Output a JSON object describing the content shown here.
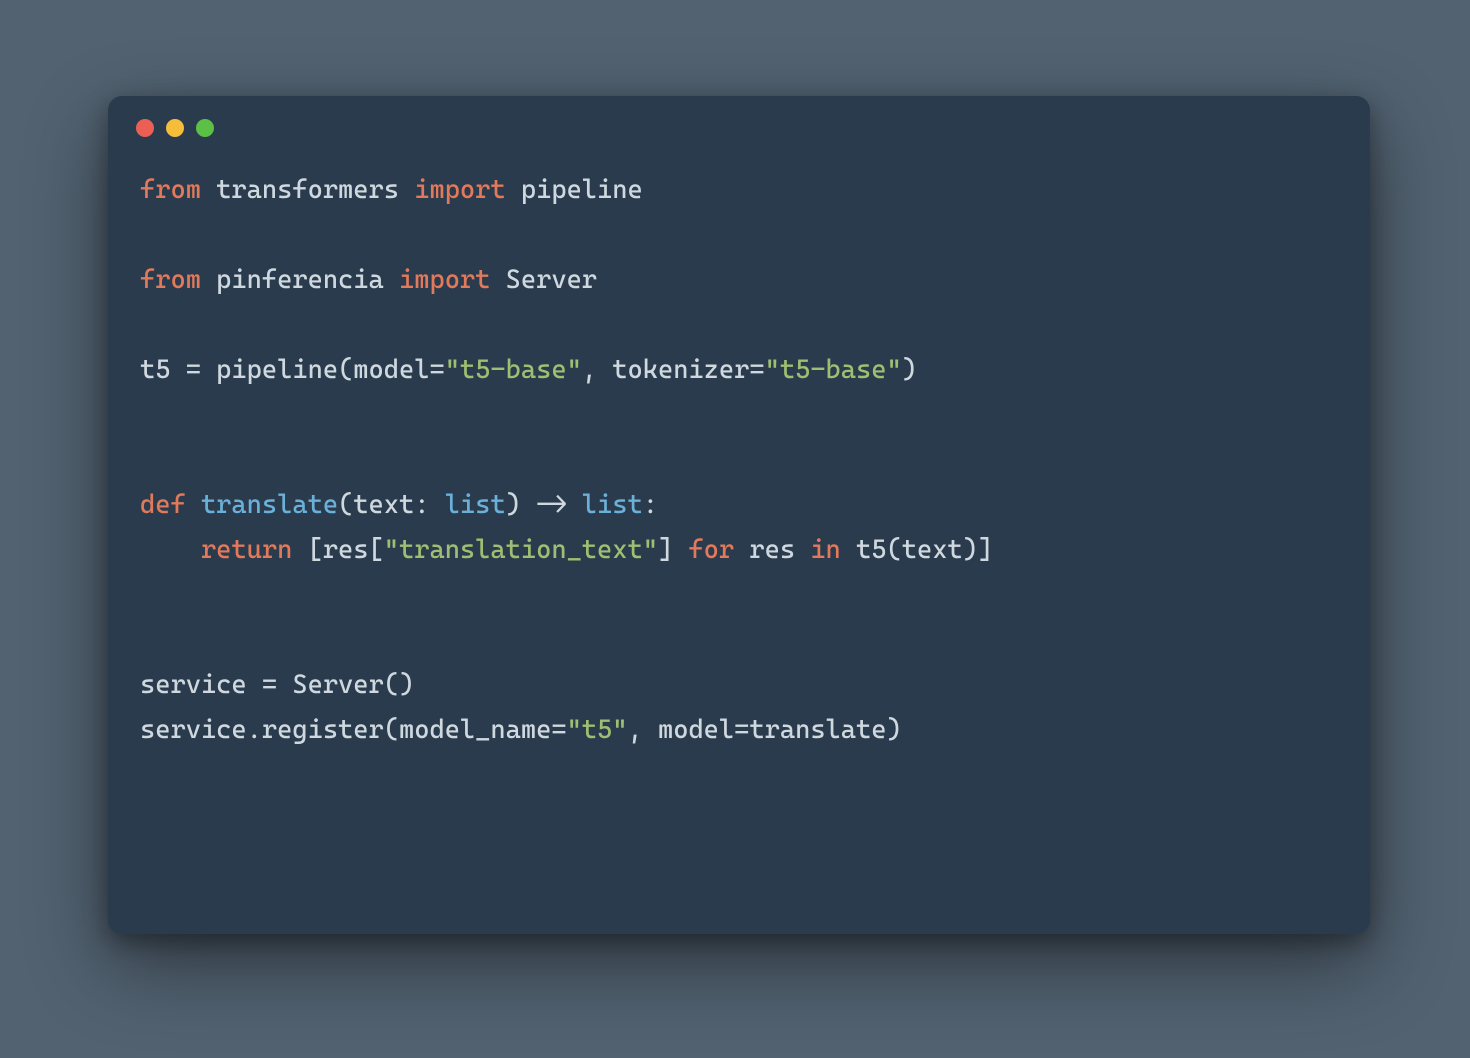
{
  "traffic_lights": {
    "red": "#ec5f55",
    "yellow": "#f6bd3b",
    "green": "#5bc146"
  },
  "code": {
    "l1": {
      "from": "from",
      "mod1": "transformers",
      "import": "import",
      "name1": "pipeline"
    },
    "l2": "",
    "l3": {
      "from": "from",
      "mod2": "pinferencia",
      "import": "import",
      "name2": "Server"
    },
    "l4": "",
    "l5": {
      "a": "t5 = pipeline(model=",
      "s1": "\"t5-base\"",
      "b": ", tokenizer=",
      "s2": "\"t5-base\"",
      "c": ")"
    },
    "l6": "",
    "l7": "",
    "l8": {
      "def": "def",
      "fn": "translate",
      "sig_a": "(text: ",
      "type1": "list",
      "sig_b": ") -> ",
      "type2": "list",
      "sig_c": ":"
    },
    "l9": {
      "indent": "    ",
      "return": "return",
      "a": " [res[",
      "s": "\"translation_text\"",
      "b": "] ",
      "for": "for",
      "c": " res ",
      "in": "in",
      "d": " t5(text)]"
    },
    "l10": "",
    "l11": "",
    "l12": "service = Server()",
    "l13": {
      "a": "service.register(model_name=",
      "s": "\"t5\"",
      "b": ", model=translate)"
    }
  }
}
